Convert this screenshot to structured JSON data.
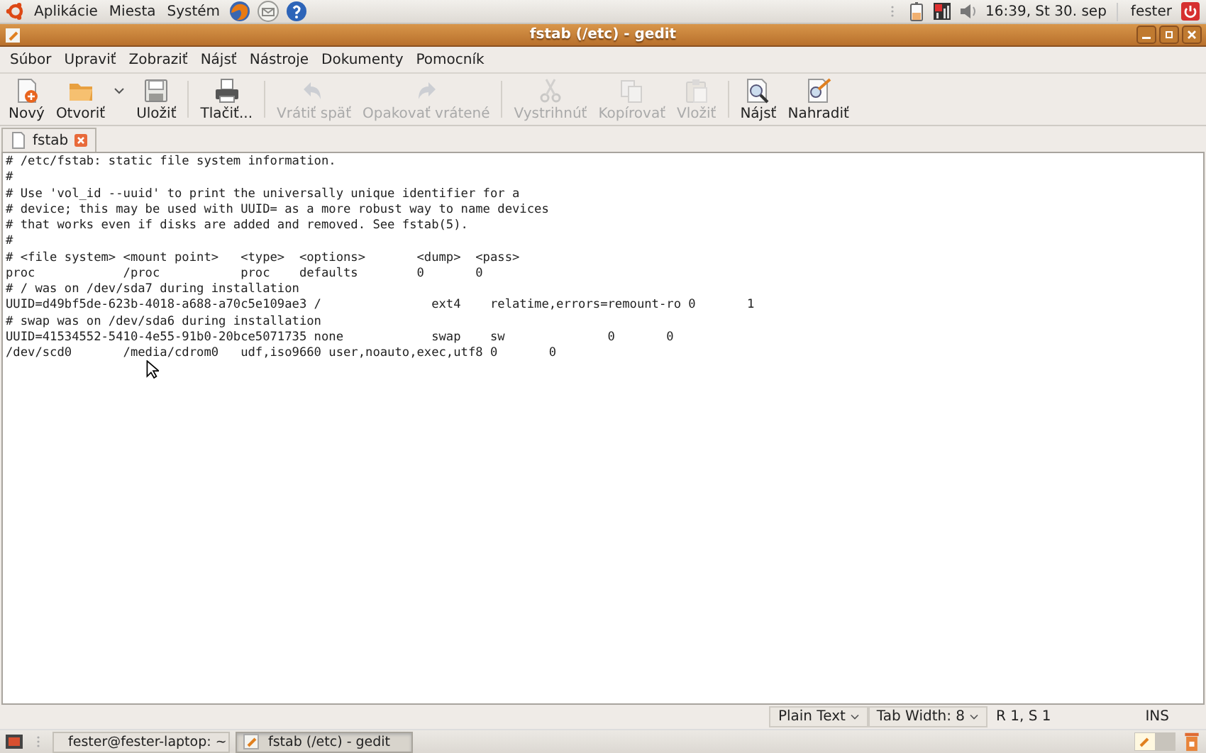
{
  "top_panel": {
    "menus": [
      "Aplikácie",
      "Miesta",
      "Systém"
    ],
    "clock": "16:39, St 30. sep",
    "user": "fester"
  },
  "window": {
    "title": "fstab (/etc) - gedit"
  },
  "menubar": [
    "Súbor",
    "Upraviť",
    "Zobraziť",
    "Nájsť",
    "Nástroje",
    "Dokumenty",
    "Pomocník"
  ],
  "toolbar": [
    [
      {
        "label": "Nový",
        "disabled": false,
        "menu": false
      },
      {
        "label": "Otvoriť",
        "disabled": false,
        "menu": true
      },
      {
        "label": "Uložiť",
        "disabled": false,
        "menu": false
      }
    ],
    [
      {
        "label": "Tlačiť...",
        "disabled": false,
        "menu": false
      }
    ],
    [
      {
        "label": "Vrátiť späť",
        "disabled": true,
        "menu": false
      },
      {
        "label": "Opakovať vrátené",
        "disabled": true,
        "menu": false
      }
    ],
    [
      {
        "label": "Vystrihnúť",
        "disabled": true,
        "menu": false
      },
      {
        "label": "Kopírovať",
        "disabled": true,
        "menu": false
      },
      {
        "label": "Vložiť",
        "disabled": true,
        "menu": false
      }
    ],
    [
      {
        "label": "Nájsť",
        "disabled": false,
        "menu": false
      },
      {
        "label": "Nahradiť",
        "disabled": false,
        "menu": false
      }
    ]
  ],
  "tabs": [
    {
      "label": "fstab",
      "selected": true
    }
  ],
  "editor": {
    "lines": [
      "# /etc/fstab: static file system information.",
      "#",
      "# Use 'vol_id --uuid' to print the universally unique identifier for a",
      "# device; this may be used with UUID= as a more robust way to name devices",
      "# that works even if disks are added and removed. See fstab(5).",
      "#",
      "# <file system> <mount point>   <type>  <options>       <dump>  <pass>",
      "proc            /proc           proc    defaults        0       0",
      "# / was on /dev/sda7 during installation",
      "UUID=d49bf5de-623b-4018-a688-a70c5e109ae3 /               ext4    relatime,errors=remount-ro 0       1",
      "# swap was on /dev/sda6 during installation",
      "UUID=41534552-5410-4e55-91b0-20bce5071735 none            swap    sw              0       0",
      "/dev/scd0       /media/cdrom0   udf,iso9660 user,noauto,exec,utf8 0       0"
    ]
  },
  "status_bar": {
    "language": "Plain Text",
    "tab_width": "Tab Width:  8",
    "position": "R 1, S 1",
    "mode": "INS"
  },
  "taskbar": [
    {
      "label": "fester@fester-laptop: ~",
      "selected": false
    },
    {
      "label": "fstab (/etc) - gedit",
      "selected": true
    }
  ]
}
